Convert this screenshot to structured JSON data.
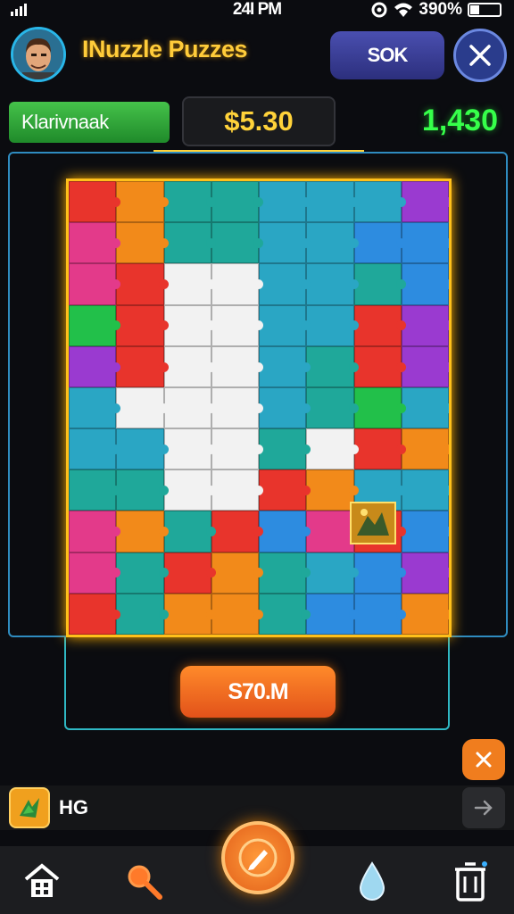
{
  "status_bar": {
    "time": "24I PM",
    "battery": "390%"
  },
  "header": {
    "title": "INuzzle Puzzes",
    "top_button_label": "SOK"
  },
  "info_row": {
    "player_name": "Klarivnaak",
    "money": "$5.30",
    "score": "1,430"
  },
  "board": {
    "columns": 8,
    "rows": 11,
    "palette": {
      "r": "#e8342c",
      "o": "#f28a1a",
      "t": "#1fa89a",
      "c": "#2aa6c4",
      "b": "#2d8ce0",
      "p": "#9a3ad0",
      "m": "#e33a8a",
      "g": "#22c04a",
      "e": "#f2f2f2"
    },
    "layout": [
      "rottcccp",
      "mottccbb",
      "mreecctb",
      "greeccrp",
      "preectrp",
      "ceeectgc",
      "cceetero",
      "tteerocc",
      "motrbmrb",
      "mtrotcbp",
      "rtootbbo"
    ]
  },
  "action_button_label": "S70.M",
  "notice": {
    "label": "HG"
  },
  "icons": {
    "avatar": "avatar-portrait",
    "close": "close-icon",
    "dismiss": "close-icon",
    "notice": "puzzle-piece-icon",
    "arrow": "arrow-right-icon",
    "nav": [
      "home-icon",
      "search-icon",
      "pencil-icon",
      "drop-icon",
      "trash-icon"
    ]
  },
  "colors": {
    "accent": "#ffc01a",
    "score": "#36ff4a",
    "frame": "#2f8cc0"
  }
}
